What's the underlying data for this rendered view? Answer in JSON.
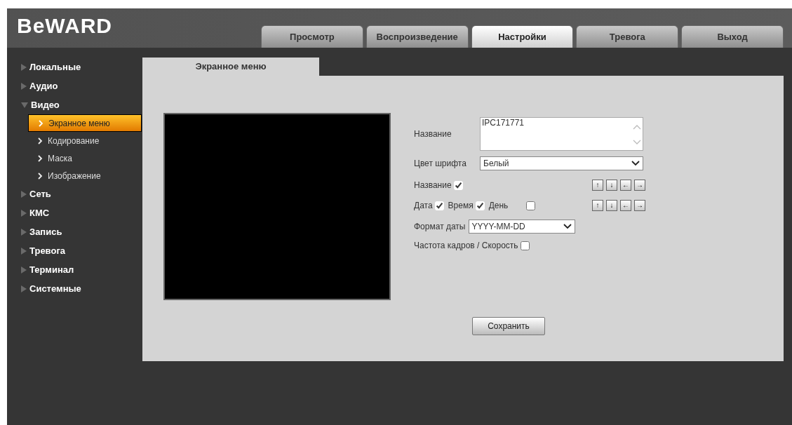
{
  "logo": "BeWARD",
  "tabs": [
    {
      "label": "Просмотр",
      "selected": false
    },
    {
      "label": "Воспроизведение",
      "selected": false
    },
    {
      "label": "Настройки",
      "selected": true
    },
    {
      "label": "Тревога",
      "selected": false
    },
    {
      "label": "Выход",
      "selected": false
    }
  ],
  "sidebar": {
    "items": [
      {
        "label": "Локальные",
        "expanded": false
      },
      {
        "label": "Аудио",
        "expanded": false
      },
      {
        "label": "Видео",
        "expanded": true,
        "children": [
          {
            "label": "Экранное меню",
            "selected": true
          },
          {
            "label": "Кодирование",
            "selected": false
          },
          {
            "label": "Маска",
            "selected": false
          },
          {
            "label": "Изображение",
            "selected": false
          }
        ]
      },
      {
        "label": "Сеть",
        "expanded": false
      },
      {
        "label": "КМС",
        "expanded": false
      },
      {
        "label": "Запись",
        "expanded": false
      },
      {
        "label": "Тревога",
        "expanded": false
      },
      {
        "label": "Терминал",
        "expanded": false
      },
      {
        "label": "Системные",
        "expanded": false
      }
    ]
  },
  "panel_tab": {
    "label": "Экранное меню",
    "selected": true
  },
  "form": {
    "name": {
      "label": "Название",
      "value": "IPC171771"
    },
    "font_color": {
      "label": "Цвет шрифта",
      "value": "Белый"
    },
    "title_row": {
      "items": [
        {
          "label": "Название",
          "checked": true
        }
      ],
      "arrows": [
        "↑",
        "↓",
        "←",
        "→"
      ]
    },
    "time_row": {
      "items": [
        {
          "label": "Дата",
          "checked": true
        },
        {
          "label": "Время",
          "checked": true
        },
        {
          "label": "День",
          "checked": false
        }
      ],
      "arrows": [
        "↑",
        "↓",
        "←",
        "→"
      ]
    },
    "date_format": {
      "label": "Формат даты",
      "value": "YYYY-MM-DD"
    },
    "fps": {
      "label": "Частота кадров / Скорость",
      "checked": false
    },
    "save_button": "Сохранить"
  }
}
